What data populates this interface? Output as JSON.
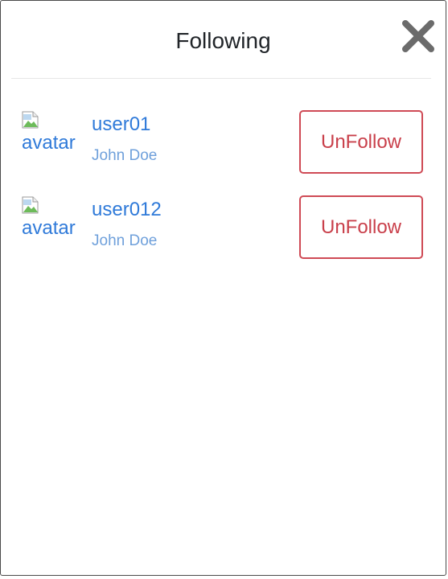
{
  "modal": {
    "title": "Following",
    "close_icon": "close-icon"
  },
  "users": [
    {
      "avatar_alt": "avatar",
      "username": "user01",
      "full_name": "John Doe",
      "action_label": "UnFollow"
    },
    {
      "avatar_alt": "avatar",
      "username": "user012",
      "full_name": "John Doe",
      "action_label": "UnFollow"
    }
  ],
  "colors": {
    "username": "#2f7ad9",
    "full_name": "#6fa0db",
    "unfollow": "#c9404b",
    "title": "#212529",
    "close_icon": "#6b6b6b"
  }
}
